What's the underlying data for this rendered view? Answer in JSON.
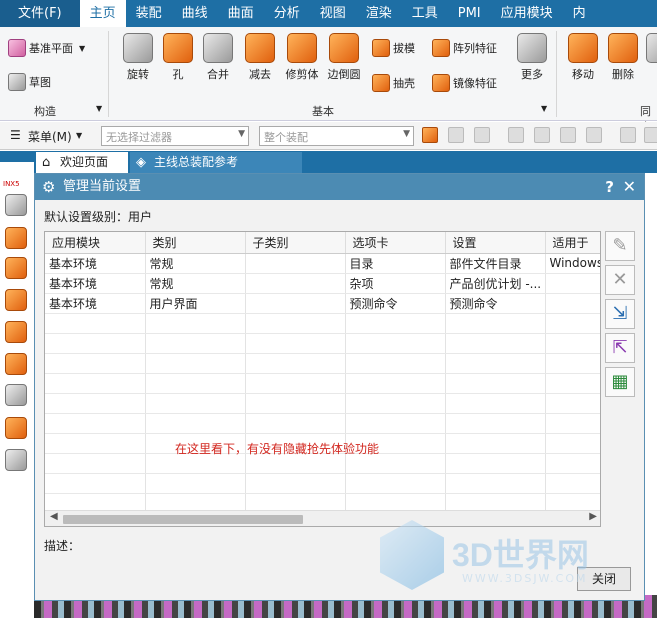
{
  "menubar": {
    "items": [
      "文件(F)",
      "主页",
      "装配",
      "曲线",
      "曲面",
      "分析",
      "视图",
      "渲染",
      "工具",
      "PMI",
      "应用模块",
      "内"
    ],
    "active": "主页"
  },
  "ribbon": {
    "left": {
      "datum_plane": "基准平面",
      "sketch": "草图",
      "group": "构造"
    },
    "buttons": [
      "旋转",
      "孔",
      "合并",
      "减去",
      "修剪体",
      "边倒圆"
    ],
    "small": [
      "拔模",
      "阵列特征",
      "抽壳",
      "镜像特征"
    ],
    "more": "更多",
    "group_basic": "基本",
    "right_buttons": [
      "移动",
      "删除"
    ],
    "group_sync": "同步"
  },
  "toolbar": {
    "menu": "菜单(M)",
    "filter_placeholder": "无选择过滤器",
    "assembly_placeholder": "整个装配"
  },
  "tabs": {
    "welcome": "欢迎页面",
    "file": "主线总装配参考_x_t.prt"
  },
  "left_label": "INX5",
  "dialog": {
    "title": "管理当前设置",
    "default_level": "默认设置级别：用户",
    "columns": [
      "应用模块",
      "类别",
      "子类别",
      "选项卡",
      "设置",
      "适用于"
    ],
    "rows": [
      [
        "基本环境",
        "常规",
        "",
        "目录",
        "部件文件目录",
        "Windows"
      ],
      [
        "基本环境",
        "常规",
        "",
        "杂项",
        "产品创优计划 -...",
        ""
      ],
      [
        "基本环境",
        "用户界面",
        "",
        "预测命令",
        "预测命令",
        ""
      ]
    ],
    "note": "在这里看下，有没有隐藏抢先体验功能",
    "description_label": "描述：",
    "close_label": "关闭"
  },
  "watermark": {
    "text": "3D世界网",
    "url": "WWW.3DSJW.COM"
  },
  "colors": {
    "accent": "#1e6fa5",
    "note_red": "#d2271f",
    "dialog_title": "#4c8bb3"
  }
}
